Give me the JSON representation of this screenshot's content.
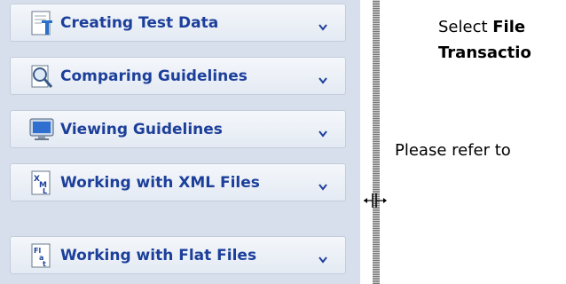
{
  "sidebar": {
    "items": [
      {
        "label": "Creating Test Data",
        "icon": "test-data-icon"
      },
      {
        "label": "Comparing Guidelines",
        "icon": "compare-magnifier-icon"
      },
      {
        "label": "Viewing Guidelines",
        "icon": "monitor-icon"
      },
      {
        "label": "Working with XML Files",
        "icon": "xml-file-icon"
      },
      {
        "label": "Working with Flat Files",
        "icon": "flat-file-icon"
      }
    ]
  },
  "content": {
    "line1_prefix": "Select",
    "line1_bold": "File",
    "line2": "Transactio",
    "line3": "Please refer to"
  },
  "colors": {
    "sidebar_bg": "#d6dfeb",
    "item_label": "#1c3f9a"
  }
}
